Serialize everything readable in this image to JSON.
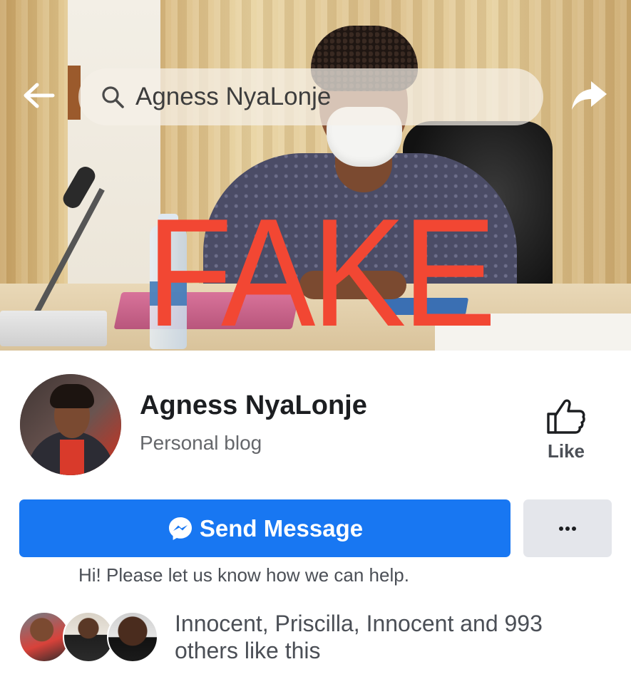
{
  "search": {
    "query": "Agness NyaLonje"
  },
  "cover": {
    "overlay_text": "FAKE",
    "overlay_color": "#f24733"
  },
  "page": {
    "name": "Agness NyaLonje",
    "category": "Personal blog",
    "like_label": "Like"
  },
  "actions": {
    "send_message_label": "Send Message",
    "more_label": "•••",
    "helper_text": "Hi! Please let us know how we can help."
  },
  "social": {
    "likes_text": "Innocent, Priscilla, Innocent and 993 others like this"
  },
  "icons": {
    "back": "arrow-left-icon",
    "share": "share-arrow-icon",
    "search": "search-icon",
    "like": "thumbs-up-icon",
    "messenger": "messenger-icon",
    "more": "more-dots-icon"
  },
  "colors": {
    "primary_button": "#1877f2",
    "secondary_button": "#e4e6eb",
    "stamp_red": "#f24733"
  }
}
